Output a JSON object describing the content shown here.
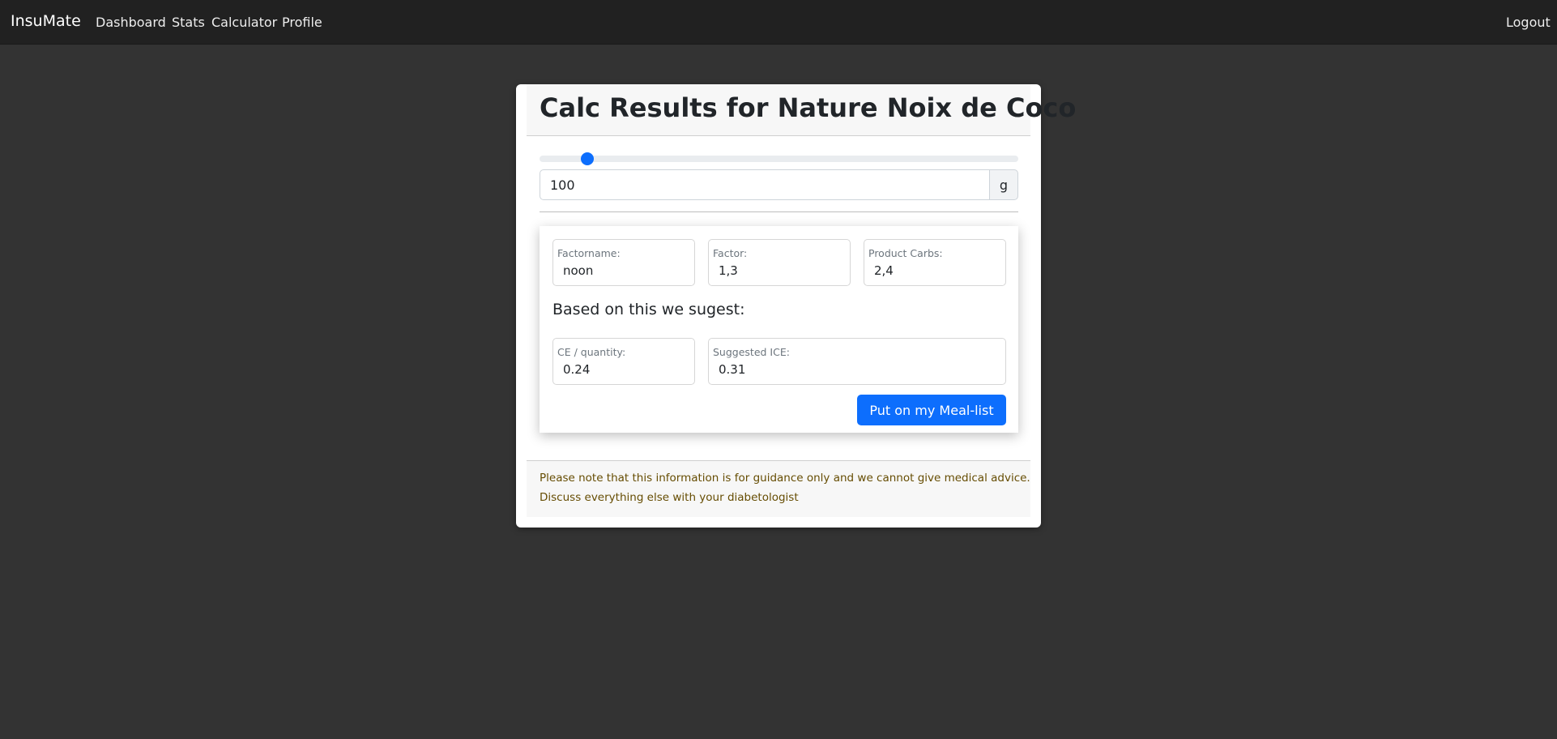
{
  "navbar": {
    "brand": "InsuMate",
    "items": [
      {
        "label": "Dashboard"
      },
      {
        "label": "Stats"
      },
      {
        "label": "Calculator"
      },
      {
        "label": "Profile"
      }
    ],
    "logout_label": "Logout"
  },
  "card": {
    "title": "Calc Results for Nature Noix de Coco",
    "slider": {
      "value": 100
    },
    "amount": {
      "value": "100",
      "unit": "g"
    },
    "fields": {
      "factorname": {
        "label": "Factorname:",
        "value": "noon"
      },
      "factor": {
        "label": "Factor:",
        "value": "1,3"
      },
      "product_carbs": {
        "label": "Product Carbs:",
        "value": "2,4"
      }
    },
    "suggest_heading": "Based on this we sugest:",
    "suggestions": {
      "ce_quantity": {
        "label": "CE / quantity:",
        "value": "0.24"
      },
      "suggested_ice": {
        "label": "Suggested ICE:",
        "value": "0.31"
      }
    },
    "meal_button_label": "Put on my Meal-list",
    "footer": {
      "line1": "Please note that this information is for guidance only and we cannot give medical advice.",
      "line2": "Discuss everything else with your diabetologist"
    }
  },
  "colors": {
    "navbar_bg": "#212121",
    "page_bg": "#333333",
    "accent": "#0d6efd",
    "footer_text": "#664d03"
  }
}
